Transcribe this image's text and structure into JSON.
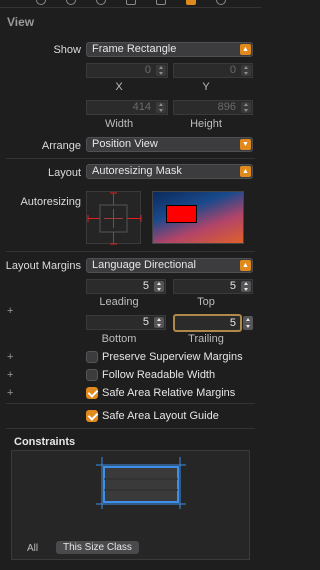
{
  "section_title": "View",
  "show": {
    "label": "Show",
    "value": "Frame Rectangle"
  },
  "frame": {
    "x": {
      "value": "0",
      "caption": "X"
    },
    "y": {
      "value": "0",
      "caption": "Y"
    },
    "width": {
      "value": "414",
      "caption": "Width"
    },
    "height": {
      "value": "896",
      "caption": "Height"
    }
  },
  "arrange": {
    "label": "Arrange",
    "value": "Position View"
  },
  "layout": {
    "label": "Layout",
    "value": "Autoresizing Mask"
  },
  "autoresizing": {
    "label": "Autoresizing"
  },
  "layout_margins": {
    "label": "Layout Margins",
    "value": "Language Directional",
    "leading": {
      "value": "5",
      "caption": "Leading"
    },
    "top": {
      "value": "5",
      "caption": "Top"
    },
    "bottom": {
      "value": "5",
      "caption": "Bottom"
    },
    "trailing": {
      "value": "5",
      "caption": "Trailing"
    }
  },
  "checkboxes": [
    {
      "label": "Preserve Superview Margins",
      "checked": false
    },
    {
      "label": "Follow Readable Width",
      "checked": false
    },
    {
      "label": "Safe Area Relative Margins",
      "checked": true
    },
    {
      "label": "Safe Area Layout Guide",
      "checked": true
    }
  ],
  "constraints": {
    "title": "Constraints",
    "tabs": [
      {
        "label": "All",
        "selected": false
      },
      {
        "label": "This Size Class",
        "selected": true
      }
    ]
  },
  "colors": {
    "accent": "#e08a1e",
    "focus": "#b0884a",
    "constraint_blue": "#3f8ee8",
    "preview_red": "#ff0000"
  }
}
